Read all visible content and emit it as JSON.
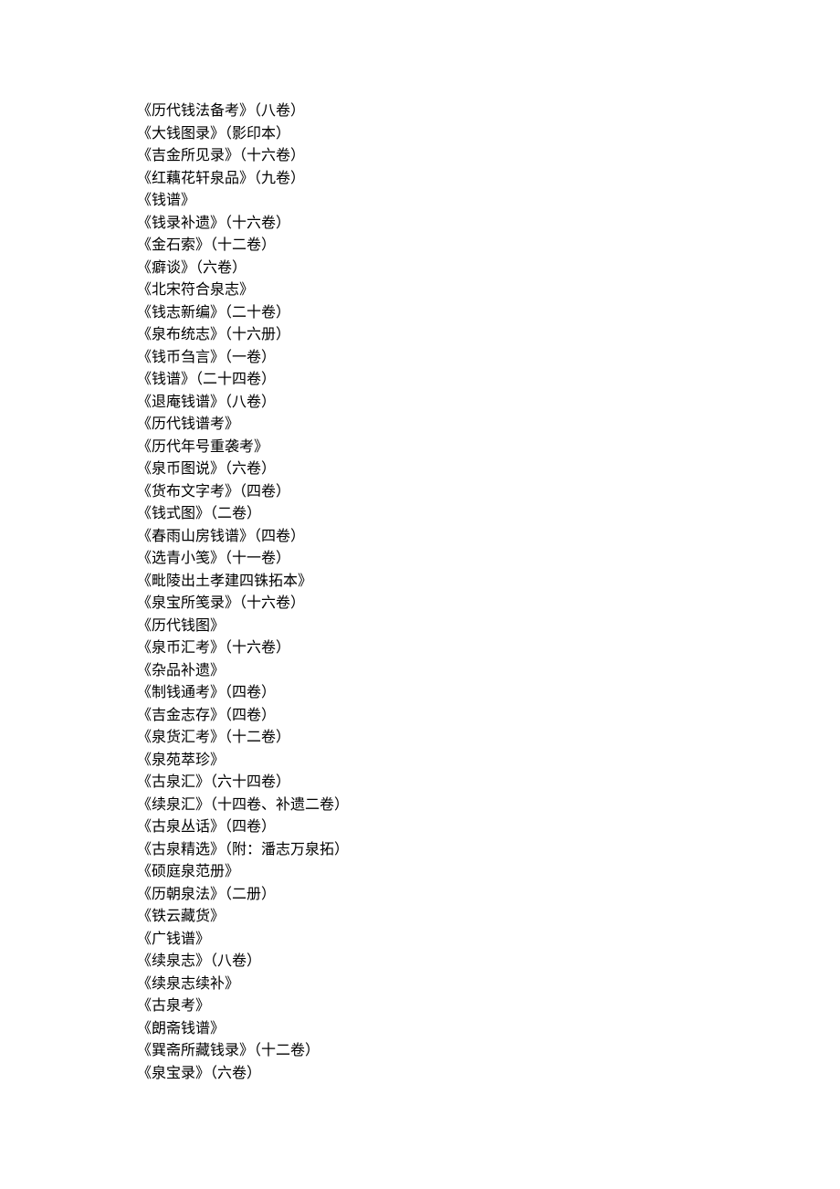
{
  "items": [
    "《历代钱法备考》（八卷）",
    "《大钱图录》（影印本）",
    "《吉金所见录》（十六卷）",
    "《红藕花轩泉品》（九卷）",
    "《钱谱》",
    "《钱录补遗》（十六卷）",
    "《金石索》（十二卷）",
    "《癖谈》（六卷）",
    "《北宋符合泉志》",
    "《钱志新编》（二十卷）",
    "《泉布统志》（十六册）",
    "《钱币刍言》（一卷）",
    "《钱谱》（二十四卷）",
    "《退庵钱谱》（八卷）",
    "《历代钱谱考》",
    "《历代年号重袭考》",
    "《泉币图说》（六卷）",
    "《货布文字考》（四卷）",
    "《钱式图》（二卷）",
    "《春雨山房钱谱》（四卷）",
    "《选青小笺》（十一卷）",
    "《毗陵出土孝建四铢拓本》",
    "《泉宝所笺录》（十六卷）",
    "《历代钱图》",
    "《泉币汇考》（十六卷）",
    "《杂品补遗》",
    "《制钱通考》（四卷）",
    "《吉金志存》（四卷）",
    "《泉货汇考》（十二卷）",
    "《泉苑萃珍》",
    "《古泉汇》（六十四卷）",
    "《续泉汇》（十四卷、补遗二卷）",
    "《古泉丛话》（四卷）",
    "《古泉精选》（附：潘志万泉拓）",
    "《硕庭泉范册》",
    "《历朝泉法》（二册）",
    "《铁云藏货》",
    "《广钱谱》",
    "《续泉志》（八卷）",
    "《续泉志续补》",
    "《古泉考》",
    "《朗斋钱谱》",
    "《巽斋所藏钱录》（十二卷）",
    "《泉宝录》（六卷）"
  ]
}
